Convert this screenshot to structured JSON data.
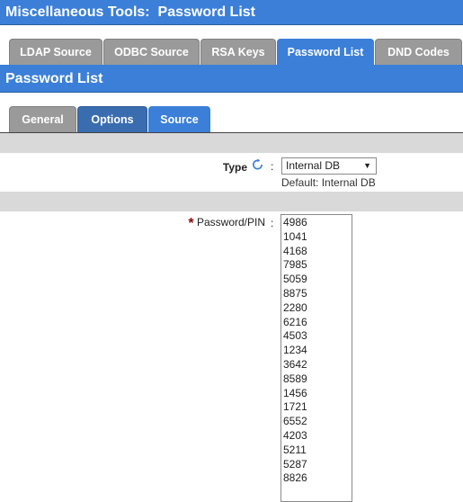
{
  "window": {
    "title": "Miscellaneous Tools:  Password List"
  },
  "top_tabs": [
    {
      "label": "LDAP Source"
    },
    {
      "label": "ODBC Source"
    },
    {
      "label": "RSA Keys"
    },
    {
      "label": "Password List"
    },
    {
      "label": "DND Codes"
    }
  ],
  "section": {
    "title": "Password List"
  },
  "sub_tabs": [
    {
      "label": "General"
    },
    {
      "label": "Options"
    },
    {
      "label": "Source"
    }
  ],
  "type_field": {
    "label": "Type",
    "separator": ":",
    "selected": "Internal DB",
    "default_note": "Default: Internal DB"
  },
  "password_field": {
    "required_marker": "*",
    "label": "Password/PIN",
    "separator": ":",
    "values": [
      "4986",
      "1041",
      "4168",
      "7985",
      "5059",
      "8875",
      "2280",
      "6216",
      "4503",
      "1234",
      "3642",
      "8589",
      "1456",
      "1721",
      "6552",
      "4203",
      "5211",
      "5287",
      "8826"
    ]
  },
  "colors": {
    "accent": "#3b7fd9",
    "tab_grey": "#9a9a9a",
    "tab_dark": "#3a6db0",
    "required": "#8b0000"
  }
}
